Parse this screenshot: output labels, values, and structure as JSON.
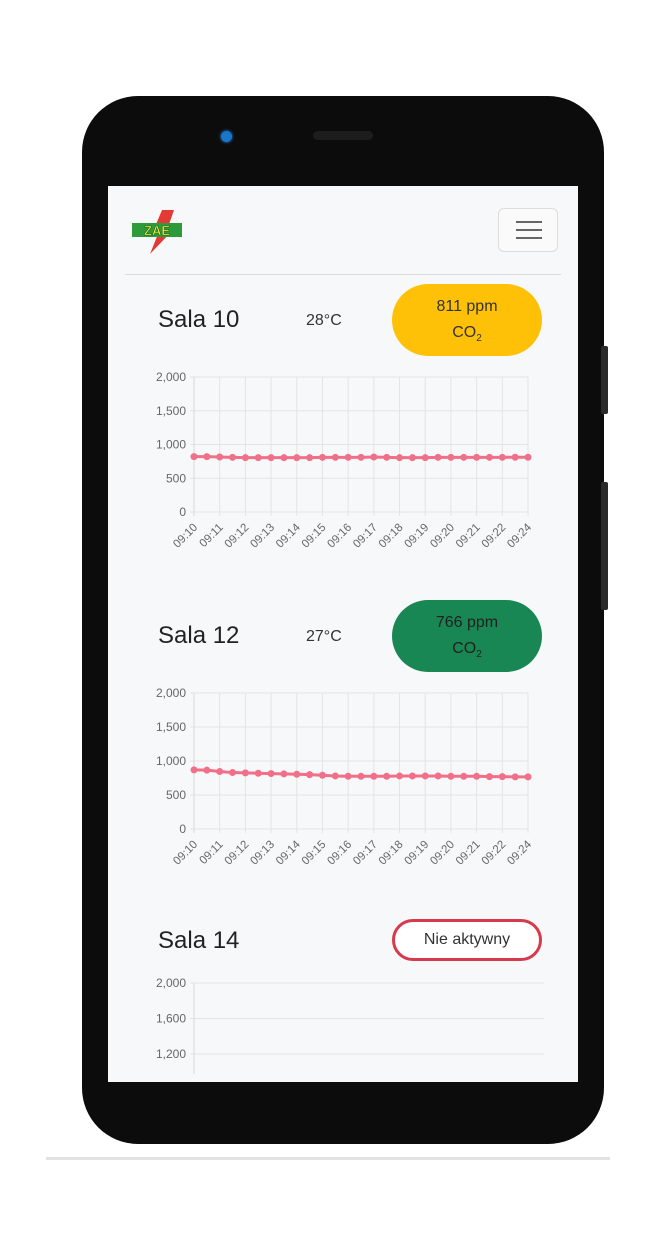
{
  "header": {
    "logo_text": "ZAE"
  },
  "icons": {
    "logo": "zae-logo-icon",
    "menu": "hamburger-menu-icon"
  },
  "colors": {
    "warning": "#ffc107",
    "good": "#198754",
    "inactive_border": "#dc3545",
    "series": "#f0708a"
  },
  "rooms": [
    {
      "name": "Sala 10",
      "temperature": "28°C",
      "co2_value": "811 ppm",
      "co2_unit_base": "CO",
      "co2_unit_sub": "2",
      "status": "warning"
    },
    {
      "name": "Sala 12",
      "temperature": "27°C",
      "co2_value": "766 ppm",
      "co2_unit_base": "CO",
      "co2_unit_sub": "2",
      "status": "good"
    },
    {
      "name": "Sala 14",
      "status_label": "Nie aktywny"
    }
  ],
  "chart_data": [
    {
      "type": "line",
      "x": [
        "09:10",
        "09:11",
        "09:12",
        "09:13",
        "09:14",
        "09:15",
        "09:16",
        "09:17",
        "09:18",
        "09:19",
        "09:20",
        "09:21",
        "09:22",
        "09:24"
      ],
      "ylim": [
        0,
        2000
      ],
      "yticks": [
        "2,000",
        "1,500",
        "1,000",
        "500",
        "0"
      ],
      "ytick_values": [
        2000,
        1500,
        1000,
        500,
        0
      ],
      "series": [
        {
          "values": [
            820,
            820,
            815,
            810,
            805,
            805,
            805,
            805,
            805,
            805,
            810,
            810,
            810,
            810,
            815,
            810,
            805,
            805,
            805,
            810,
            810,
            810,
            810,
            810,
            810,
            811,
            811
          ]
        }
      ],
      "grid": true
    },
    {
      "type": "line",
      "x": [
        "09:10",
        "09:11",
        "09:12",
        "09:13",
        "09:14",
        "09:15",
        "09:16",
        "09:17",
        "09:18",
        "09:19",
        "09:20",
        "09:21",
        "09:22",
        "09:24"
      ],
      "ylim": [
        0,
        2000
      ],
      "yticks": [
        "2,000",
        "1,500",
        "1,000",
        "500",
        "0"
      ],
      "ytick_values": [
        2000,
        1500,
        1000,
        500,
        0
      ],
      "series": [
        {
          "values": [
            870,
            865,
            845,
            830,
            825,
            820,
            815,
            810,
            805,
            800,
            790,
            780,
            775,
            775,
            775,
            775,
            780,
            780,
            780,
            780,
            775,
            775,
            775,
            770,
            770,
            766,
            766
          ]
        }
      ],
      "grid": true
    },
    {
      "type": "line",
      "x": [],
      "ylim": [
        1200,
        2000
      ],
      "yticks": [
        "2,000",
        "1,600",
        "1,200"
      ],
      "ytick_values": [
        2000,
        1600,
        1200
      ],
      "series": [],
      "grid": true
    }
  ]
}
